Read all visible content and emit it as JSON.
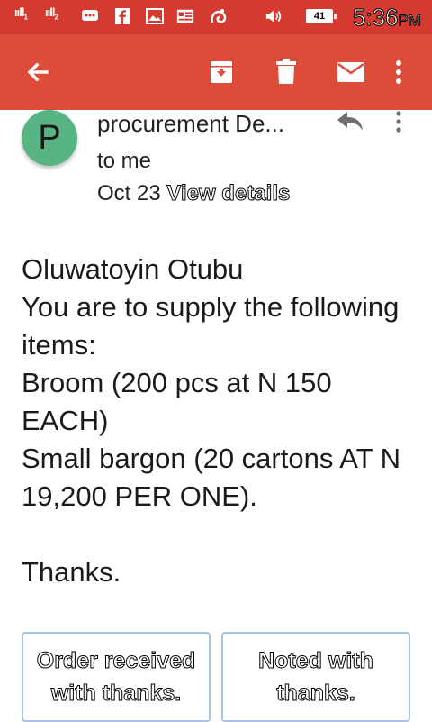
{
  "status_bar": {
    "signal_1": "ııll",
    "signal_1_sub": "1",
    "signal_2": "ııll",
    "signal_2_sub": "2",
    "battery_level": "41",
    "time": "5:36",
    "time_suffix": "PM",
    "icons": [
      "chat-icon",
      "facebook-icon",
      "gallery-icon",
      "news-icon",
      "uc-browser-icon",
      "volume-icon"
    ]
  },
  "toolbar": {
    "icons": [
      "back-arrow-icon",
      "archive-icon",
      "delete-icon",
      "mark-unread-icon",
      "more-icon"
    ]
  },
  "email": {
    "avatar_letter": "P",
    "sender": "procurement De...",
    "recipient": "to me",
    "date": "Oct 23",
    "view_details": "View details",
    "body": "Oluwatoyin Otubu\nYou are to supply the following items:\nBroom (200 pcs at N 150 EACH)\nSmall bargon (20 cartons AT N 19,200 PER ONE).\n\nThanks."
  },
  "smart_replies": [
    {
      "label": "Order received with thanks."
    },
    {
      "label": "Noted with thanks."
    }
  ],
  "colors": {
    "status_bar": "#d43a2f",
    "toolbar": "#dd4b39",
    "avatar": "#58b483",
    "reply_border": "#a9c3e8"
  }
}
